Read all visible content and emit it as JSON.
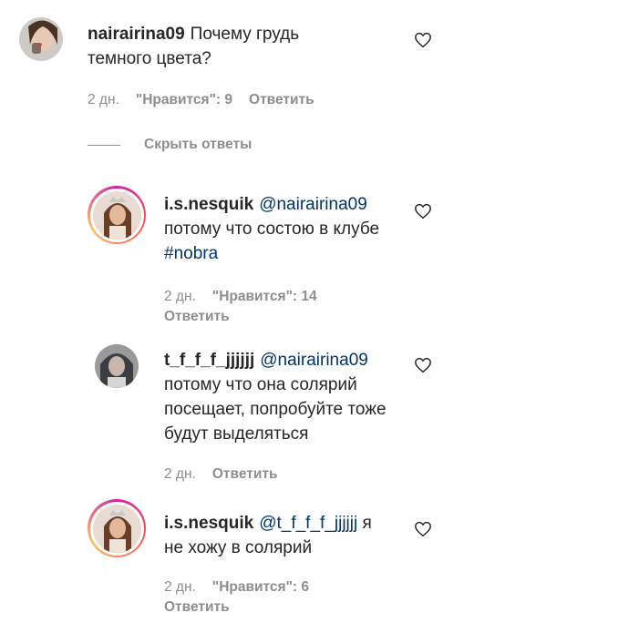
{
  "comments": [
    {
      "username": "nairairina09",
      "mention": "",
      "text_before": "",
      "text": "Почему грудь темного цвета?",
      "hashtag": "",
      "time": "2 дн.",
      "likes": "\"Нравится\": 9",
      "reply": "Ответить"
    },
    {
      "username": "i.s.nesquik",
      "mention": "@nairairina09",
      "text": "потому что состою в клубе",
      "hashtag": "#nobra",
      "time": "2 дн.",
      "likes": "\"Нравится\": 14",
      "reply": "Ответить"
    },
    {
      "username": "t_f_f_f_jjjjjj",
      "mention": "@nairairina09",
      "text": "потому что она солярий посещает, попробуйте тоже будут выделяться",
      "hashtag": "",
      "time": "2 дн.",
      "likes": "",
      "reply": "Ответить"
    },
    {
      "username": "i.s.nesquik",
      "mention": "@t_f_f_f_jjjjjj",
      "text": "я не хожу в солярий",
      "hashtag": "",
      "time": "2 дн.",
      "likes": "\"Нравится\": 6",
      "reply": "Ответить"
    }
  ],
  "hide_replies_label": "Скрыть ответы",
  "colors": {
    "text": "#262626",
    "meta": "#8e8e8e",
    "mention": "#003569",
    "heart": "#262626"
  },
  "icons": [
    "heart-outline-icon"
  ]
}
